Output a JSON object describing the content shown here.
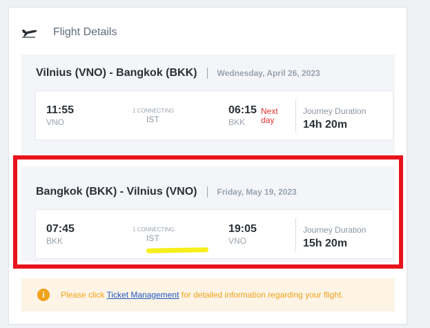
{
  "header": {
    "title": "Flight Details",
    "icon": "plane-takeoff-icon"
  },
  "segments": [
    {
      "route": "Vilnius (VNO) - Bangkok (BKK)",
      "date": "Wednesday, April 26, 2023",
      "departure": {
        "time": "11:55",
        "code": "VNO"
      },
      "connection": {
        "label": "1 CONNECTING",
        "code": "IST"
      },
      "arrival": {
        "time": "06:15",
        "code": "BKK",
        "note": "Next day"
      },
      "duration": {
        "label": "Journey Duration",
        "value": "14h 20m"
      }
    },
    {
      "route": "Bangkok (BKK) - Vilnius (VNO)",
      "date": "Friday, May 19, 2023",
      "departure": {
        "time": "07:45",
        "code": "BKK"
      },
      "connection": {
        "label": "1 CONNECTING",
        "code": "IST"
      },
      "arrival": {
        "time": "19:05",
        "code": "VNO"
      },
      "duration": {
        "label": "Journey Duration",
        "value": "15h 20m"
      }
    }
  ],
  "notice": {
    "before": "Please click ",
    "link": "Ticket Management",
    "after": " for detailed information regarding your flight.",
    "icon": "info-icon"
  },
  "colors": {
    "accent_warning": "#f0a21c",
    "next_day": "#e0312f",
    "link": "#1f56c4",
    "annotation_box": "#e8131b",
    "annotation_highlight": "#f6ef1a"
  }
}
